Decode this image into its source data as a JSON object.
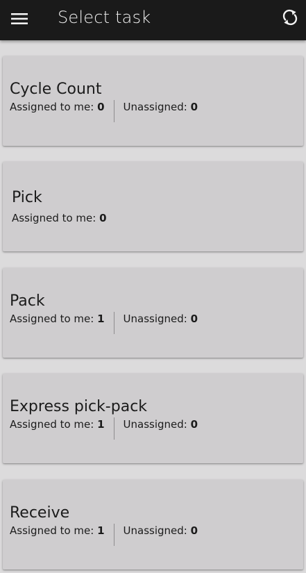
{
  "app_bar": {
    "title": "Select task",
    "menu_icon": "hamburger-menu-icon",
    "refresh_icon": "refresh-icon",
    "background": "#1a1a1a"
  },
  "tasks": [
    {
      "title": "Cycle Count",
      "assigned_label": "Assigned to me: ",
      "assigned_value": "0",
      "unassigned_label": "Unassigned: ",
      "unassigned_value": "0"
    },
    {
      "title": "Pick",
      "assigned_label": "Assigned to me: ",
      "assigned_value": "0"
    },
    {
      "title": "Pack",
      "assigned_label": "Assigned to me: ",
      "assigned_value": "1",
      "unassigned_label": "Unassigned: ",
      "unassigned_value": "0"
    },
    {
      "title": "Express pick-pack",
      "assigned_label": "Assigned to me: ",
      "assigned_value": "1",
      "unassigned_label": "Unassigned: ",
      "unassigned_value": "0"
    },
    {
      "title": "Receive",
      "assigned_label": "Assigned to me: ",
      "assigned_value": "1",
      "unassigned_label": "Unassigned: ",
      "unassigned_value": "0"
    }
  ]
}
